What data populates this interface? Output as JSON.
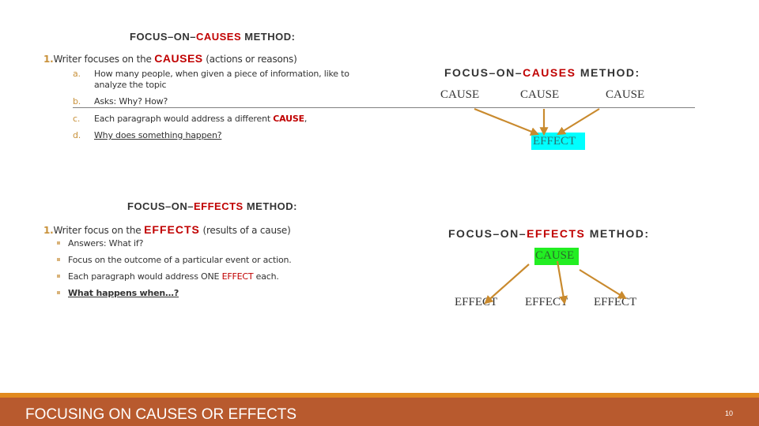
{
  "left": {
    "causes": {
      "heading": {
        "pre": "FOCUS–ON–",
        "accent": "CAUSES",
        "post": " METHOD:"
      },
      "point": {
        "num": "1.",
        "pre": "Writer focuses on the ",
        "accent": "CAUSES",
        "post": "  (actions or reasons)"
      },
      "items": [
        {
          "letter": "a.",
          "line1": "How many people, when given a piece of information, like to",
          "line2": "analyze the topic"
        },
        {
          "letter": "b.",
          "text": "Asks:  Why? How?"
        },
        {
          "letter": "c.",
          "pre": "Each paragraph would address a different ",
          "accent": "CAUSE",
          "post": ","
        },
        {
          "letter": "d.",
          "text": "Why does something happen?"
        }
      ]
    },
    "effects": {
      "heading": {
        "pre": "FOCUS–ON–",
        "accent": "EFFECTS",
        "post": " METHOD:"
      },
      "point": {
        "num": "1.",
        "pre": "Writer focus on the ",
        "accent": "EFFECTS",
        "post": " (results of a cause)"
      },
      "bullets": [
        {
          "text": "Answers: What if?"
        },
        {
          "text": "Focus on the outcome of a particular event or action."
        },
        {
          "pre": "Each paragraph would address ONE ",
          "accent": "EFFECT",
          "post": " each."
        },
        {
          "text": "What happens when…?"
        }
      ]
    }
  },
  "right": {
    "causes_diagram": {
      "heading": {
        "pre": "FOCUS–ON–",
        "accent": "CAUSES",
        "post": " METHOD:"
      },
      "causes": [
        "CAUSE",
        "CAUSE",
        "CAUSE"
      ],
      "effect": "EFFECT",
      "effect_highlight": "#00ffff"
    },
    "effects_diagram": {
      "heading": {
        "pre": "FOCUS–ON–",
        "accent": "EFFECTS",
        "post": " METHOD:"
      },
      "cause": "CAUSE",
      "cause_highlight": "#22ee22",
      "effects": [
        "EFFECT",
        "EFFECT",
        "EFFECT"
      ]
    }
  },
  "colors": {
    "accent_red": "#c00000",
    "arrow": "#c98a2e",
    "footer": "#b85a2e",
    "footer_stripe": "#e28a1f",
    "numbering": "#c8913a"
  },
  "footer": {
    "title": "FOCUSING ON CAUSES OR EFFECTS",
    "page_number": "10"
  }
}
